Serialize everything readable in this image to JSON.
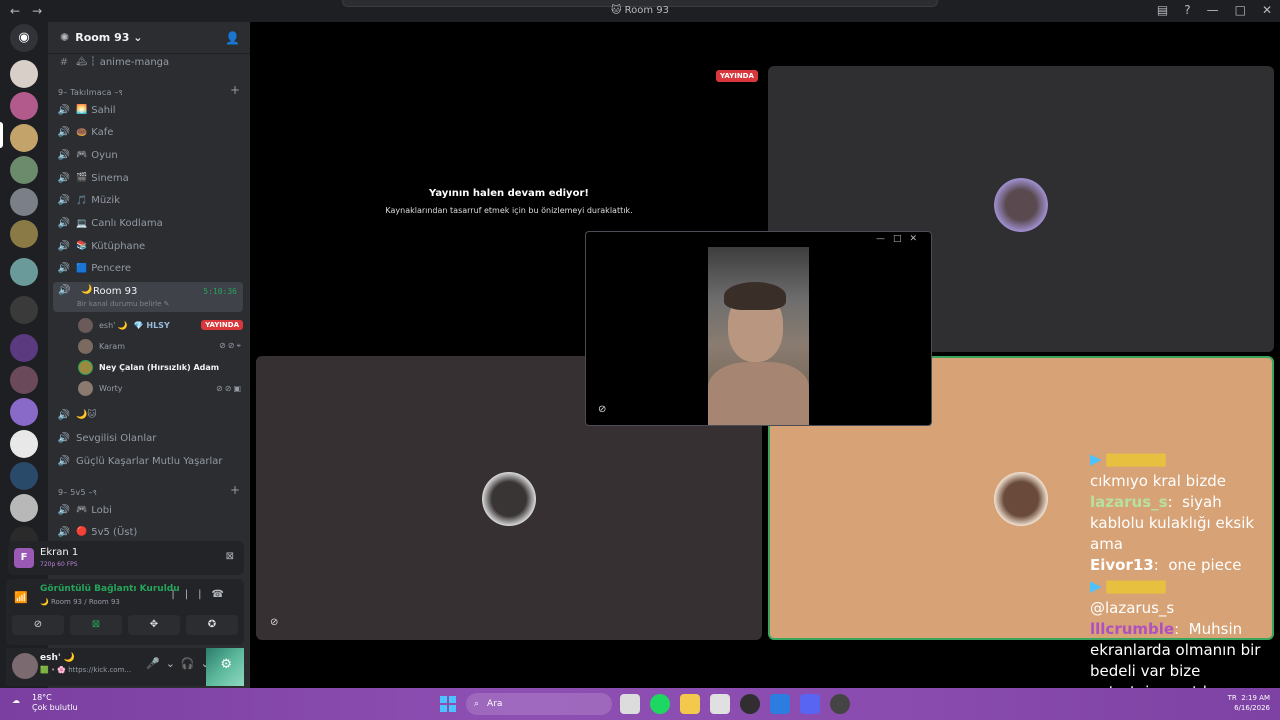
{
  "window": {
    "title": "Room 93"
  },
  "server": {
    "name": "Room 93"
  },
  "channels": {
    "top_channel": "anime-manga",
    "cat1": "9– Takılmaca –९",
    "voice": [
      {
        "emoji": "🌅",
        "name": "Sahil"
      },
      {
        "emoji": "🍩",
        "name": "Kafe"
      },
      {
        "emoji": "🎮",
        "name": "Oyun"
      },
      {
        "emoji": "🎬",
        "name": "Sinema"
      },
      {
        "emoji": "🎵",
        "name": "Müzik"
      },
      {
        "emoji": "💻",
        "name": "Canlı Kodlama"
      },
      {
        "emoji": "📚",
        "name": "Kütüphane"
      },
      {
        "emoji": "🟦",
        "name": "Pencere"
      }
    ],
    "active": {
      "emoji": "🌙",
      "name": "Room 93",
      "timer": "5:10:36",
      "status": "Bir kanal durumu belirle ✎"
    },
    "members": [
      {
        "name": "esh' 🌙",
        "tag": "HLSY",
        "badge": "YAYINDA"
      },
      {
        "name": "Karam",
        "icons": "⊘⊘⌖"
      },
      {
        "name": "Ney Çalan (Hırsızlık) Adam"
      },
      {
        "name": "Worty",
        "icons": "⊘⊘▣"
      }
    ],
    "after": [
      {
        "emoji": "🌙🐱",
        "name": ""
      },
      {
        "emoji": "",
        "name": "Sevgilisi Olanlar"
      },
      {
        "emoji": "",
        "name": "Güçlü Kaşarlar Mutlu Yaşarlar"
      }
    ],
    "cat2": "9– 5v5 –९",
    "cat2_channels": [
      {
        "emoji": "🎮",
        "name": "Lobi"
      },
      {
        "emoji": "🔴",
        "name": "5v5 (Üst)"
      }
    ]
  },
  "screen_share": {
    "name": "Ekran 1",
    "quality": "720p 60 FPS"
  },
  "voice_panel": {
    "status": "Görüntülü Bağlantı Kuruldu",
    "location": "🌙 Room 93 / Room 93"
  },
  "user_panel": {
    "name": "esh' 🌙",
    "status": "🟩 • 🌸 https://kick.com..."
  },
  "stream": {
    "badge": "YAYINDA",
    "title": "Yayının halen devam ediyor!",
    "subtitle": "Kaynaklarından tasarruf etmek için bu önizlemeyi duraklattık."
  },
  "chat": [
    {
      "user": "lllcrumble",
      "text": "Muhsin ekranlarda olmanın bir bedeli var bize entertainment lazım"
    },
    {
      "user": "",
      "text": "cıkmıyo kral bizde"
    },
    {
      "user": "lazarus_s",
      "text": "siyah kablolu kulaklığı eksik ama"
    },
    {
      "user": "Eivor13",
      "text": "one piece"
    },
    {
      "user": "",
      "text": "@lazarus_s"
    }
  ],
  "taskbar": {
    "temp": "18°C",
    "weather": "Çok bulutlu",
    "search": "Ara",
    "time": "2:19 AM",
    "date": "6/16/2026",
    "lang": "TR"
  },
  "colors": {
    "accent_green": "#23a55a",
    "live_red": "#da373c",
    "tile_orange": "#d6a276",
    "taskbar_purple": "#8e4fb3"
  }
}
